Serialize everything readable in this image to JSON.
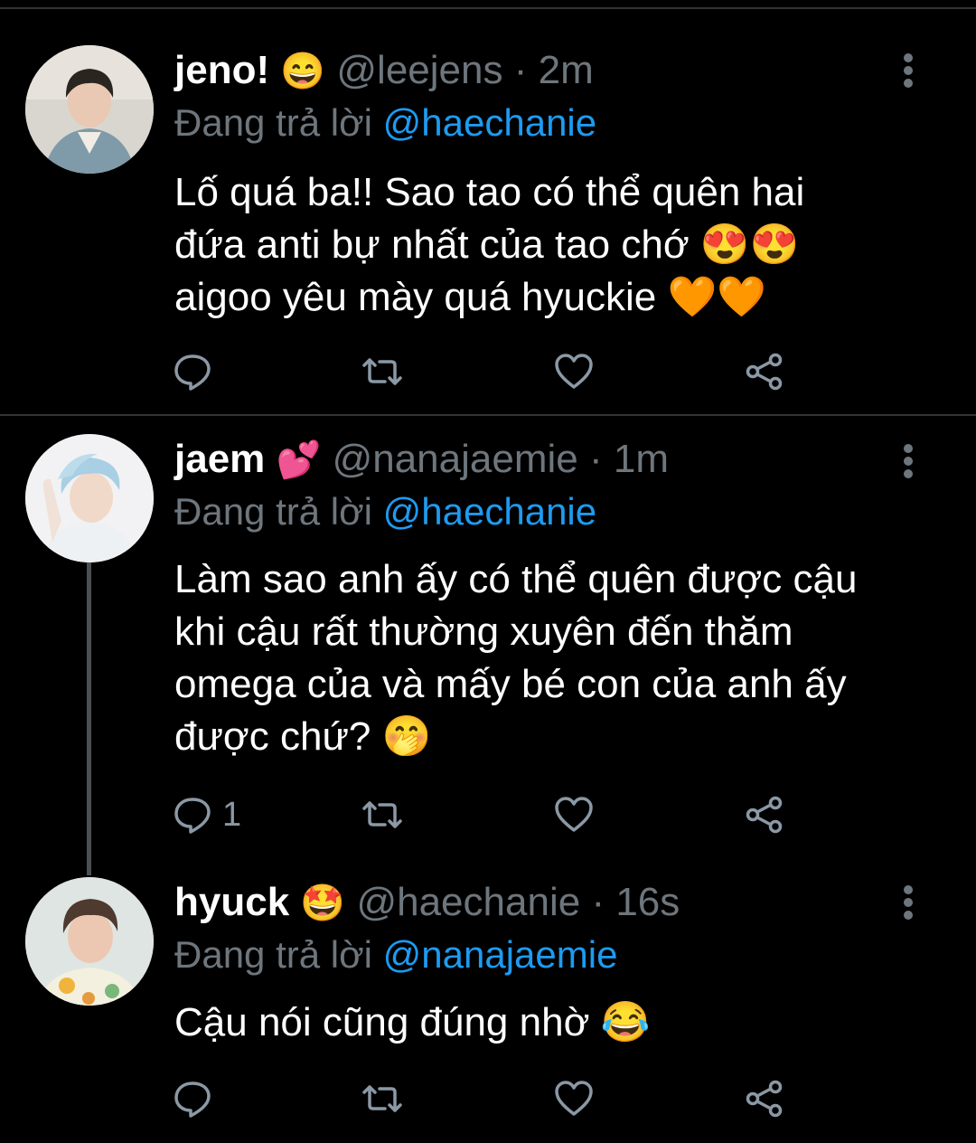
{
  "tweets": [
    {
      "name": "jeno!",
      "name_emoji": "😄",
      "handle": "@leejens",
      "dot": "·",
      "time": "2m",
      "reply_prefix": "Đang trả lời",
      "reply_to": "@haechanie",
      "lines": [
        "Lố quá ba!! Sao tao có thể quên hai",
        "đứa anti bự nhất của tao chớ 😍😍",
        "aigoo yêu mày quá hyuckie 🧡🧡"
      ],
      "reply_count": ""
    },
    {
      "name": "jaem",
      "name_emoji": "💕",
      "handle": "@nanajaemie",
      "dot": "·",
      "time": "1m",
      "reply_prefix": "Đang trả lời",
      "reply_to": "@haechanie",
      "lines": [
        "Làm sao anh ấy có thể quên được cậu",
        "khi cậu rất thường xuyên đến thăm",
        "omega của và mấy bé con của anh ấy",
        "được chứ? 🤭"
      ],
      "reply_count": "1"
    },
    {
      "name": "hyuck",
      "name_emoji": "🤩",
      "handle": "@haechanie",
      "dot": "·",
      "time": "16s",
      "reply_prefix": "Đang trả lời",
      "reply_to": "@nanajaemie",
      "lines": [
        "Cậu nói cũng đúng nhờ 😂"
      ],
      "reply_count": ""
    }
  ],
  "colors": {
    "background": "#000000",
    "secondary_text": "#6e767d",
    "mention": "#1d9bf0",
    "divider": "#2f3336"
  },
  "icons": [
    "reply-icon",
    "retweet-icon",
    "like-icon",
    "share-icon",
    "more-options-icon"
  ]
}
